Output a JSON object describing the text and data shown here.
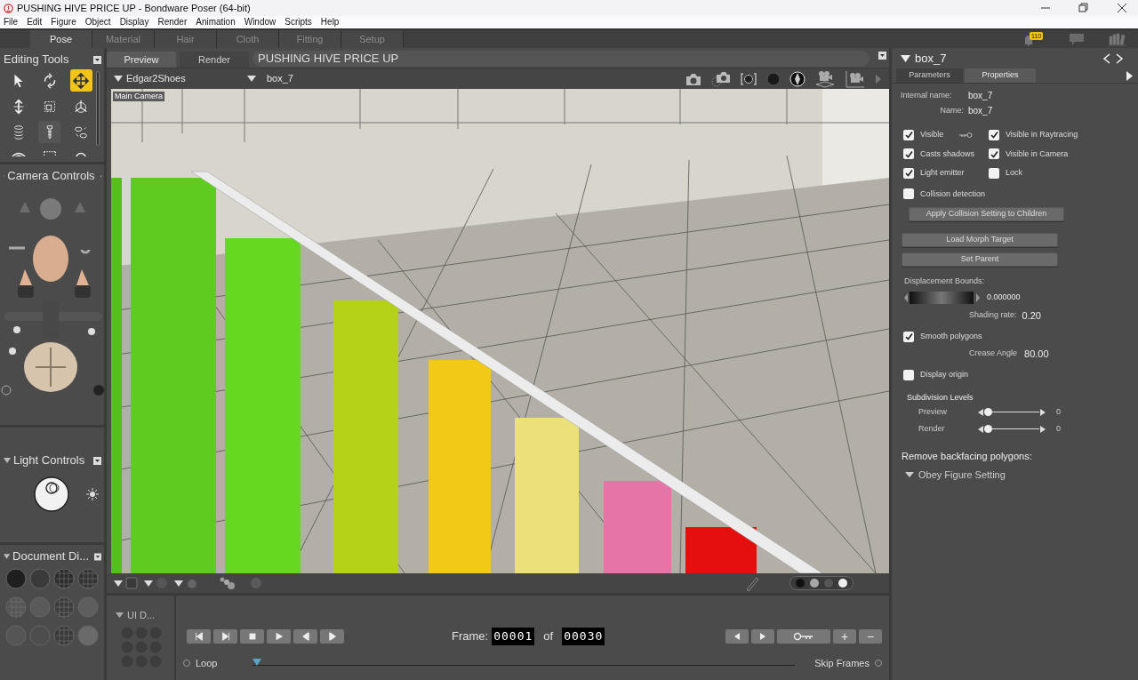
{
  "window": {
    "title": "PUSHING HIVE PRICE UP - Bondware Poser (64-bit)"
  },
  "menu": [
    "File",
    "Edit",
    "Figure",
    "Object",
    "Display",
    "Render",
    "Animation",
    "Window",
    "Scripts",
    "Help"
  ],
  "room_tabs": [
    {
      "label": "Pose",
      "selected": true
    },
    {
      "label": "Material",
      "selected": false
    },
    {
      "label": "Hair",
      "selected": false
    },
    {
      "label": "Cloth",
      "selected": false
    },
    {
      "label": "Fitting",
      "selected": false
    },
    {
      "label": "Setup",
      "selected": false
    }
  ],
  "notifications": {
    "count": "110"
  },
  "editing_tools": {
    "title": "Editing Tools",
    "tools": [
      {
        "selected": false
      },
      {
        "selected": false
      },
      {
        "selected": true
      },
      {
        "selected": false
      },
      {
        "selected": false
      },
      {
        "selected": false
      },
      {
        "selected": false
      },
      {
        "selected": false
      },
      {
        "selected": false
      },
      {
        "selected": false
      },
      {
        "selected": false
      },
      {
        "selected": false
      }
    ]
  },
  "camera_controls": {
    "title": "Camera Controls"
  },
  "light_controls": {
    "title": "Light Controls"
  },
  "document_display": {
    "title": "Document  Di..."
  },
  "document": {
    "tabs": [
      {
        "label": "Preview",
        "selected": true
      },
      {
        "label": "Render",
        "selected": false
      }
    ],
    "title": "PUSHING HIVE PRICE UP",
    "figure_menu": "Edgar2Shoes",
    "actor_menu": "box_7",
    "camera_label": "Main Camera"
  },
  "properties": {
    "actor": "box_7",
    "tabs": [
      {
        "label": "Parameters",
        "selected": false
      },
      {
        "label": "Properties",
        "selected": true
      }
    ],
    "internal_name_label": "Internal name:",
    "internal_name": "box_7",
    "name_label": "Name:",
    "name": "box_7",
    "checkboxes": [
      {
        "label": "Visible",
        "checked": true
      },
      {
        "label": "Visible in Raytracing",
        "checked": true
      },
      {
        "label": "Casts shadows",
        "checked": true
      },
      {
        "label": "Visible in Camera",
        "checked": true
      },
      {
        "label": "Light emitter",
        "checked": true
      },
      {
        "label": "Lock",
        "checked": false
      },
      {
        "label": "Collision detection",
        "checked": false
      }
    ],
    "apply_button": "Apply Collision Setting to Children",
    "buttons": [
      "Load Morph Target",
      "Set Parent"
    ],
    "displacement_label": "Displacement Bounds:",
    "displacement_value": "0.000000",
    "shading_label": "Shading rate:",
    "shading_value": "0.20",
    "smooth": {
      "label": "Smooth polygons",
      "checked": true
    },
    "crease_label": "Crease Angle",
    "crease_value": "80.00",
    "display_origin": {
      "label": "Display origin",
      "checked": false
    },
    "subdivision": {
      "title": "Subdivision Levels",
      "rows": [
        {
          "label": "Preview",
          "value": "0"
        },
        {
          "label": "Render",
          "value": "0"
        }
      ]
    },
    "backfacing": {
      "title": "Remove backfacing polygons:",
      "option": "Obey Figure Setting"
    }
  },
  "animation": {
    "ui_title": "UI D...",
    "frame_label": "Frame:",
    "frame": "00001",
    "of": "of",
    "total": "00030",
    "loop": {
      "label": "Loop",
      "on": false
    },
    "skip": {
      "label": "Skip Frames",
      "on": false
    },
    "plus": "+",
    "minus": "−"
  }
}
